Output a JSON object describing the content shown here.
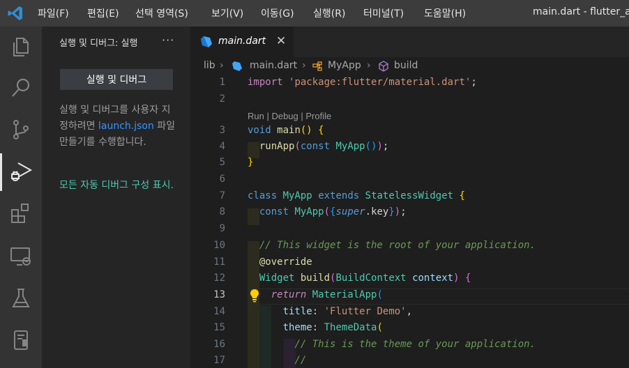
{
  "menu": [
    "파일(F)",
    "편집(E)",
    "선택 영역(S)",
    "보기(V)",
    "이동(G)",
    "실행(R)",
    "터미널(T)",
    "도움말(H)"
  ],
  "window_title": "main.dart - flutter_ap",
  "activity_bar": [
    "explorer-icon",
    "search-icon",
    "source-control-icon",
    "run-debug-icon",
    "extensions-icon",
    "remote-explorer-icon",
    "testing-icon",
    "flutter-icon"
  ],
  "sidebar": {
    "title": "실행 및 디버그: 실행",
    "more": "···",
    "run_button_label": "실행 및 디버그",
    "description_pre": "실행 및 디버그를 사용자 지정하려면 ",
    "description_link": "launch.json",
    "description_post": " 파일 만들기를 수행합니다.",
    "show_configs_link": "모든 자동 디버그 구성 표시."
  },
  "tab": {
    "label": "main.dart",
    "close": "✕"
  },
  "breadcrumb": [
    "lib",
    "main.dart",
    "MyApp",
    "build"
  ],
  "codelens": "Run | Debug | Profile",
  "line_numbers": [
    "1",
    "2",
    "3",
    "4",
    "5",
    "6",
    "7",
    "8",
    "9",
    "10",
    "11",
    "12",
    "13",
    "14",
    "15",
    "16",
    "17"
  ],
  "active_line": "13",
  "code": {
    "l1_kw": "import",
    "l1_str": "'package:flutter/material.dart'",
    "l1_end": ";",
    "l3_void": "void",
    "l3_main": "main",
    "l3_paren": "()",
    "l3_brace": "{",
    "l4_fn": "runApp",
    "l4_p1": "(",
    "l4_const": "const",
    "l4_cls": "MyApp",
    "l4_p2": "()",
    "l4_p3": ")",
    "l4_end": ";",
    "l5_brace": "}",
    "l7_class": "class",
    "l7_name": "MyApp",
    "l7_extends": "extends",
    "l7_base": "StatelessWidget",
    "l7_brace": "{",
    "l8_const": "const",
    "l8_cls": "MyApp",
    "l8_p1": "(",
    "l8_b1": "{",
    "l8_super": "super",
    "l8_key": ".key",
    "l8_b2": "}",
    "l8_p2": ")",
    "l8_end": ";",
    "l10_comment": "// This widget is the root of your application.",
    "l11_anno": "@override",
    "l12_type": "Widget",
    "l12_fn": "build",
    "l12_p1": "(",
    "l12_ctx_type": "BuildContext",
    "l12_ctx": "context",
    "l12_p2": ")",
    "l12_brace": "{",
    "l13_return": "return",
    "l13_cls": "MaterialApp",
    "l13_p": "(",
    "l14_prop": "title",
    "l14_colon": ":",
    "l14_str": "'Flutter Demo'",
    "l14_comma": ",",
    "l15_prop": "theme",
    "l15_colon": ":",
    "l15_cls": "ThemeData",
    "l15_p": "(",
    "l16_comment": "// This is the theme of your application.",
    "l17_comment": "//"
  },
  "colors": {
    "keyword": "#569cd6",
    "control": "#c586c0",
    "string": "#ce9178",
    "type": "#4ec9b0",
    "function": "#dcdcaa",
    "comment": "#6a9955",
    "annotation_arrow": "#e0221c"
  }
}
